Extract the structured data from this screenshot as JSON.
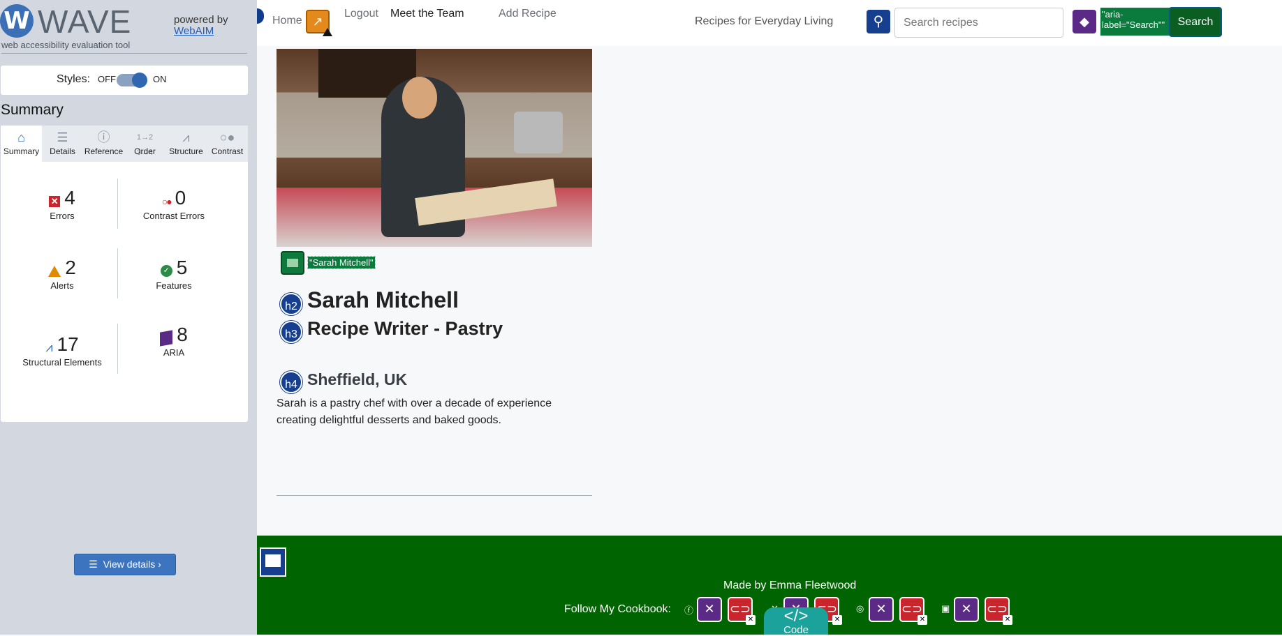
{
  "wave": {
    "logo_letter": "W",
    "title": "WAVE",
    "tagline": "web accessibility evaluation tool",
    "powered_by": "powered by",
    "webaim_link": "WebAIM",
    "styles_label": "Styles:",
    "styles_off": "OFF",
    "styles_on": "ON",
    "summary_heading": "Summary",
    "tabs": [
      {
        "label": "Summary",
        "icon": "home-icon",
        "active": true
      },
      {
        "label": "Details",
        "icon": "list-icon"
      },
      {
        "label": "Reference",
        "icon": "info-icon"
      },
      {
        "label": "Order",
        "icon": "order-icon"
      },
      {
        "label": "Structure",
        "icon": "structure-icon"
      },
      {
        "label": "Contrast",
        "icon": "contrast-icon"
      }
    ],
    "stats": {
      "errors": {
        "value": "4",
        "label": "Errors"
      },
      "contrast_errors": {
        "value": "0",
        "label": "Contrast Errors"
      },
      "alerts": {
        "value": "2",
        "label": "Alerts"
      },
      "features": {
        "value": "5",
        "label": "Features"
      },
      "structural": {
        "value": "17",
        "label": "Structural Elements"
      },
      "aria": {
        "value": "8",
        "label": "ARIA"
      }
    },
    "view_details": "View details ›"
  },
  "page": {
    "nav": {
      "home": "Home",
      "logout": "Logout",
      "team": "Meet the Team",
      "add_recipe": "Add Recipe"
    },
    "site_tagline": "Recipes for Everyday Living",
    "search_placeholder": "Search recipes",
    "aria_label_text": "\"aria-label=\"Search\"\"",
    "search_button": "Search",
    "image_alt": "\"Sarah Mitchell\"",
    "heading_h2_tag": "h2",
    "heading_h3_tag": "h3",
    "heading_h4_tag": "h4",
    "name": "Sarah Mitchell",
    "role": "Recipe Writer - Pastry",
    "location": "Sheffield, UK",
    "bio": "Sarah is a pastry chef with over a decade of experience creating delightful desserts and baked goods.",
    "footer": {
      "made_by": "Made by Emma Fleetwood",
      "follow": "Follow My Cookbook:",
      "code_label": "Code",
      "code_symbol": "</>",
      "social_icons": [
        "facebook-icon",
        "x-icon",
        "instagram-icon",
        "youtube-icon"
      ]
    }
  },
  "colors": {
    "wave_blue": "#3b6fb6",
    "error_red": "#c9252d",
    "alert_orange": "#e08a00",
    "feature_green": "#2e8b47",
    "aria_purple": "#5b2a86",
    "footer_green": "#006400"
  }
}
